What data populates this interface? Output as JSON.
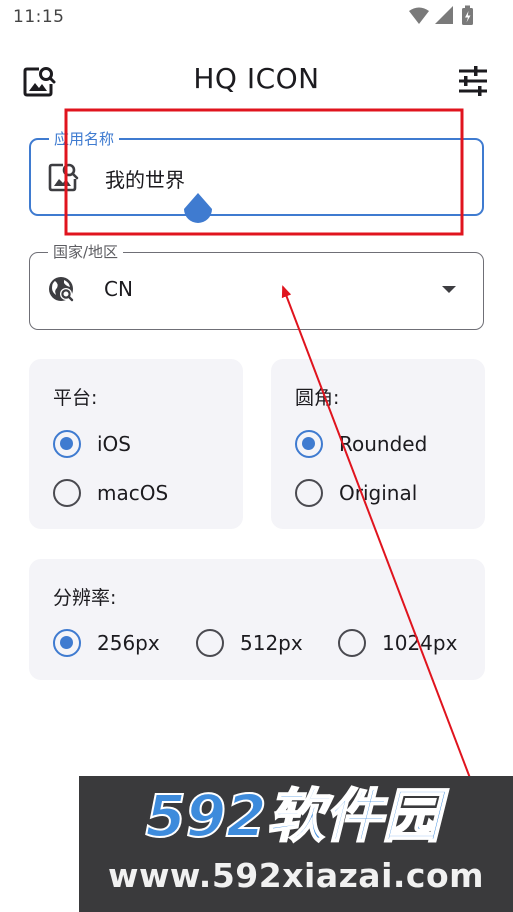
{
  "status_bar": {
    "time": "11:15"
  },
  "app_bar": {
    "title": "HQ ICON"
  },
  "app_name_field": {
    "label": "应用名称",
    "value": "我的世界"
  },
  "region_field": {
    "label": "国家/地区",
    "value": "CN"
  },
  "platform_card": {
    "title": "平台:",
    "options": [
      {
        "label": "iOS",
        "selected": true
      },
      {
        "label": "macOS",
        "selected": false
      }
    ]
  },
  "corner_card": {
    "title": "圆角:",
    "options": [
      {
        "label": "Rounded",
        "selected": true
      },
      {
        "label": "Original",
        "selected": false
      }
    ]
  },
  "resolution_card": {
    "title": "分辨率:",
    "options": [
      {
        "label": "256px",
        "selected": true
      },
      {
        "label": "512px",
        "selected": false
      },
      {
        "label": "1024px",
        "selected": false
      }
    ]
  },
  "watermark": {
    "brand": "592软件园",
    "url": "www.592xiazai.com"
  },
  "colors": {
    "accent": "#3f7bd0",
    "annotation_red": "#e0141e",
    "watermark_blue": "#3d8bdc",
    "card_bg": "#f4f4f8"
  }
}
